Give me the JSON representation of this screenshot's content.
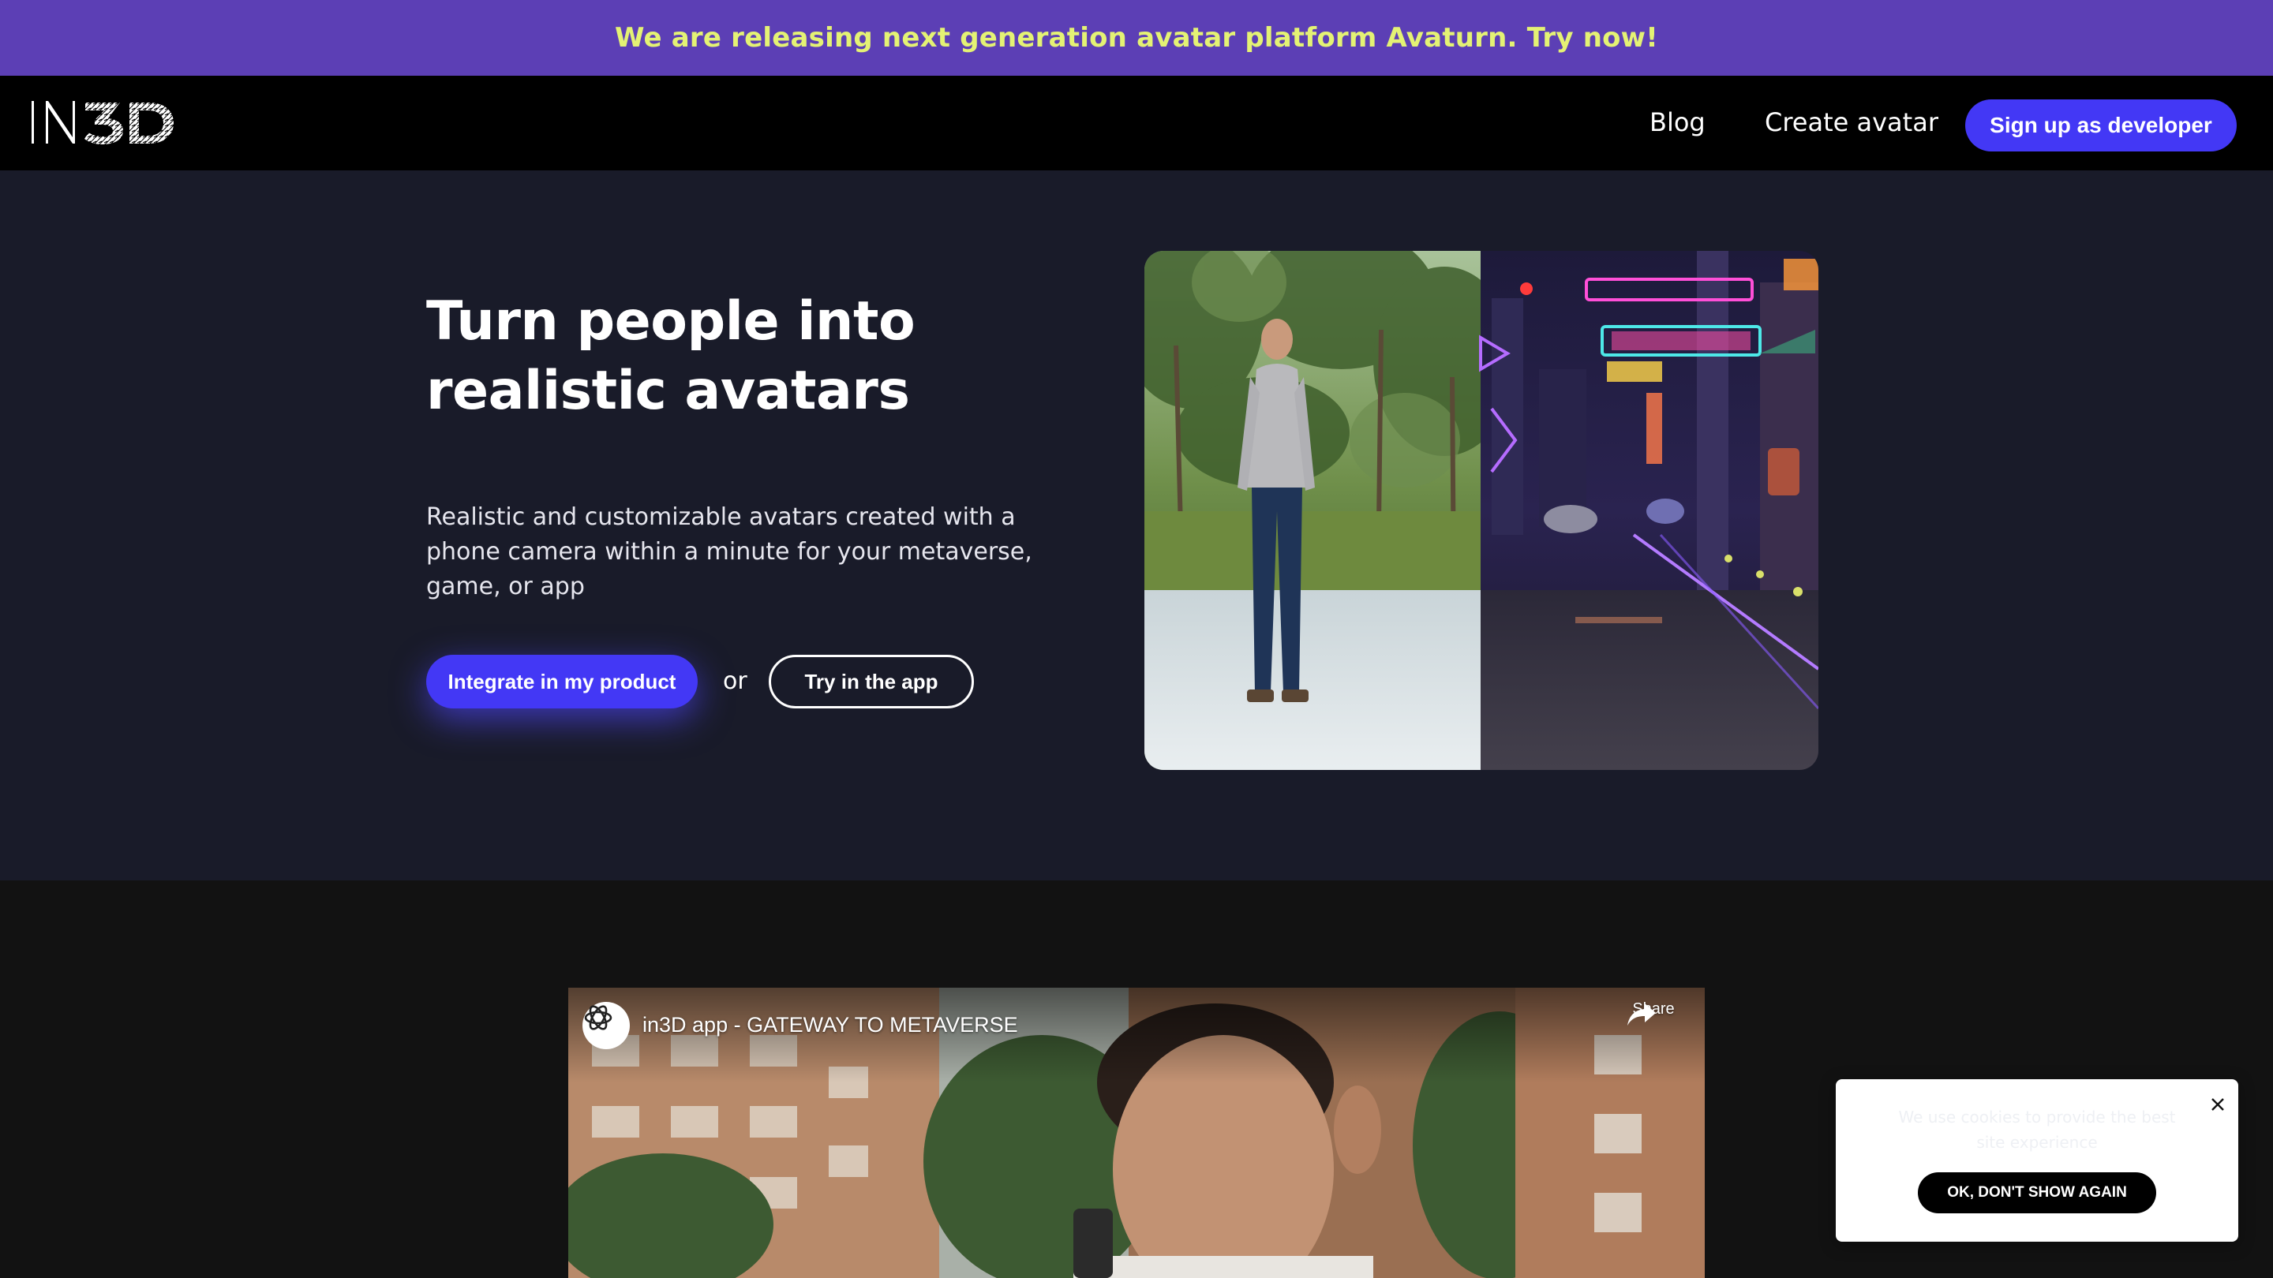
{
  "announcement": {
    "text": "We are releasing next generation avatar platform Avaturn. Try now!"
  },
  "nav": {
    "logo_text": "IN3D",
    "links": [
      "Blog",
      "Create avatar"
    ],
    "cta": "Sign up as developer"
  },
  "hero": {
    "title": "Turn people into realistic avatars",
    "subtitle": "Realistic and customizable avatars created with a phone camera within a minute for your metaverse, game, or app",
    "primary_button": "Integrate in my product",
    "or_text": "or",
    "secondary_button": "Try in the app"
  },
  "video": {
    "title": "in3D app - GATEWAY TO METAVERSE",
    "share_label": "Share"
  },
  "cookie": {
    "text": "We use cookies to provide the best site experience",
    "button": "OK, DON'T SHOW AGAIN"
  },
  "colors": {
    "announcement_bg": "#5c3fb5",
    "announcement_text": "#e4f274",
    "accent": "#4338f5",
    "hero_bg": "#191b29",
    "page_bg": "#121212"
  }
}
